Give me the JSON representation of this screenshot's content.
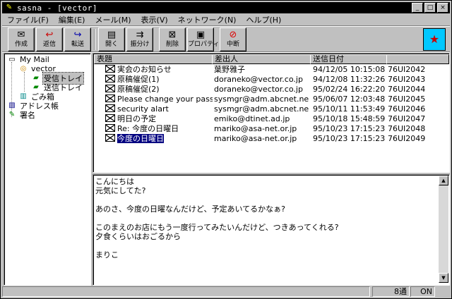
{
  "window": {
    "title": "sasna - [vector]"
  },
  "menu": [
    {
      "label": "ファイル(F)"
    },
    {
      "label": "編集(E)"
    },
    {
      "label": "メール(M)"
    },
    {
      "label": "表示(V)"
    },
    {
      "label": "ネットワーク(N)"
    },
    {
      "label": "ヘルプ(H)"
    }
  ],
  "toolbar": [
    {
      "label": "作成",
      "icon": "envelope-new-icon"
    },
    {
      "label": "返信",
      "icon": "reply-icon"
    },
    {
      "label": "転送",
      "icon": "forward-icon"
    },
    {
      "label": "開く",
      "icon": "open-icon"
    },
    {
      "label": "振分け",
      "icon": "sort-icon"
    },
    {
      "label": "削除",
      "icon": "delete-icon"
    },
    {
      "label": "プロパティ",
      "icon": "properties-icon"
    },
    {
      "label": "中断",
      "icon": "stop-icon"
    }
  ],
  "tree": [
    {
      "label": "My Mail",
      "icon": "mailbox-icon"
    },
    {
      "label": "vector",
      "icon": "account-icon"
    },
    {
      "label": "受信トレイ",
      "icon": "inbox-icon"
    },
    {
      "label": "送信トレイ",
      "icon": "outbox-icon"
    },
    {
      "label": "ごみ箱",
      "icon": "trash-icon"
    },
    {
      "label": "アドレス帳",
      "icon": "address-book-icon"
    },
    {
      "label": "署名",
      "icon": "signature-icon"
    }
  ],
  "list": {
    "columns": [
      "表題",
      "差出人",
      "送信日付",
      ""
    ],
    "rows": [
      {
        "subject": "実会のお知らせ",
        "from": "葉野雅子",
        "date": "94/12/05 10:15:08",
        "id": "76UI2042"
      },
      {
        "subject": "原稿催促(1)",
        "from": "doraneko@vector.co.jp",
        "date": "94/12/08 11:32:26",
        "id": "76UI2043"
      },
      {
        "subject": "原稿催促(2)",
        "from": "doraneko@vector.co.jp",
        "date": "95/02/24 16:22:20",
        "id": "76UI2044"
      },
      {
        "subject": "Please change your passwo...",
        "from": "sysmgr@adm.abcnet.net",
        "date": "95/06/07 12:03:48",
        "id": "76UI2045"
      },
      {
        "subject": "security alart",
        "from": "sysmgr@adm.abcnet.net",
        "date": "95/10/11 11:53:49",
        "id": "76UI2046"
      },
      {
        "subject": "明日の予定",
        "from": "emiko@dtinet.ad.jp",
        "date": "95/10/18 15:48:59",
        "id": "76UI2047"
      },
      {
        "subject": "Re: 今度の日曜日",
        "from": "mariko@asa-net.or.jp",
        "date": "95/10/23 17:15:23",
        "id": "76UI2048"
      },
      {
        "subject": "今度の日曜日",
        "from": "mariko@asa-net.or.jp",
        "date": "95/10/23 17:15:23",
        "id": "76UI2049"
      }
    ]
  },
  "preview": {
    "lines": [
      "こんにちは",
      "元気にしてた?",
      "",
      "あのさ、今度の日曜なんだけど、予定あいてるかなぁ?",
      "",
      "このまえのお店にもう一度行ってみたいんだけど、つきあってくれる?",
      "夕食くらいはおごるから",
      "",
      "まりこ"
    ]
  },
  "status": {
    "count": "8通",
    "mode": "ON"
  }
}
